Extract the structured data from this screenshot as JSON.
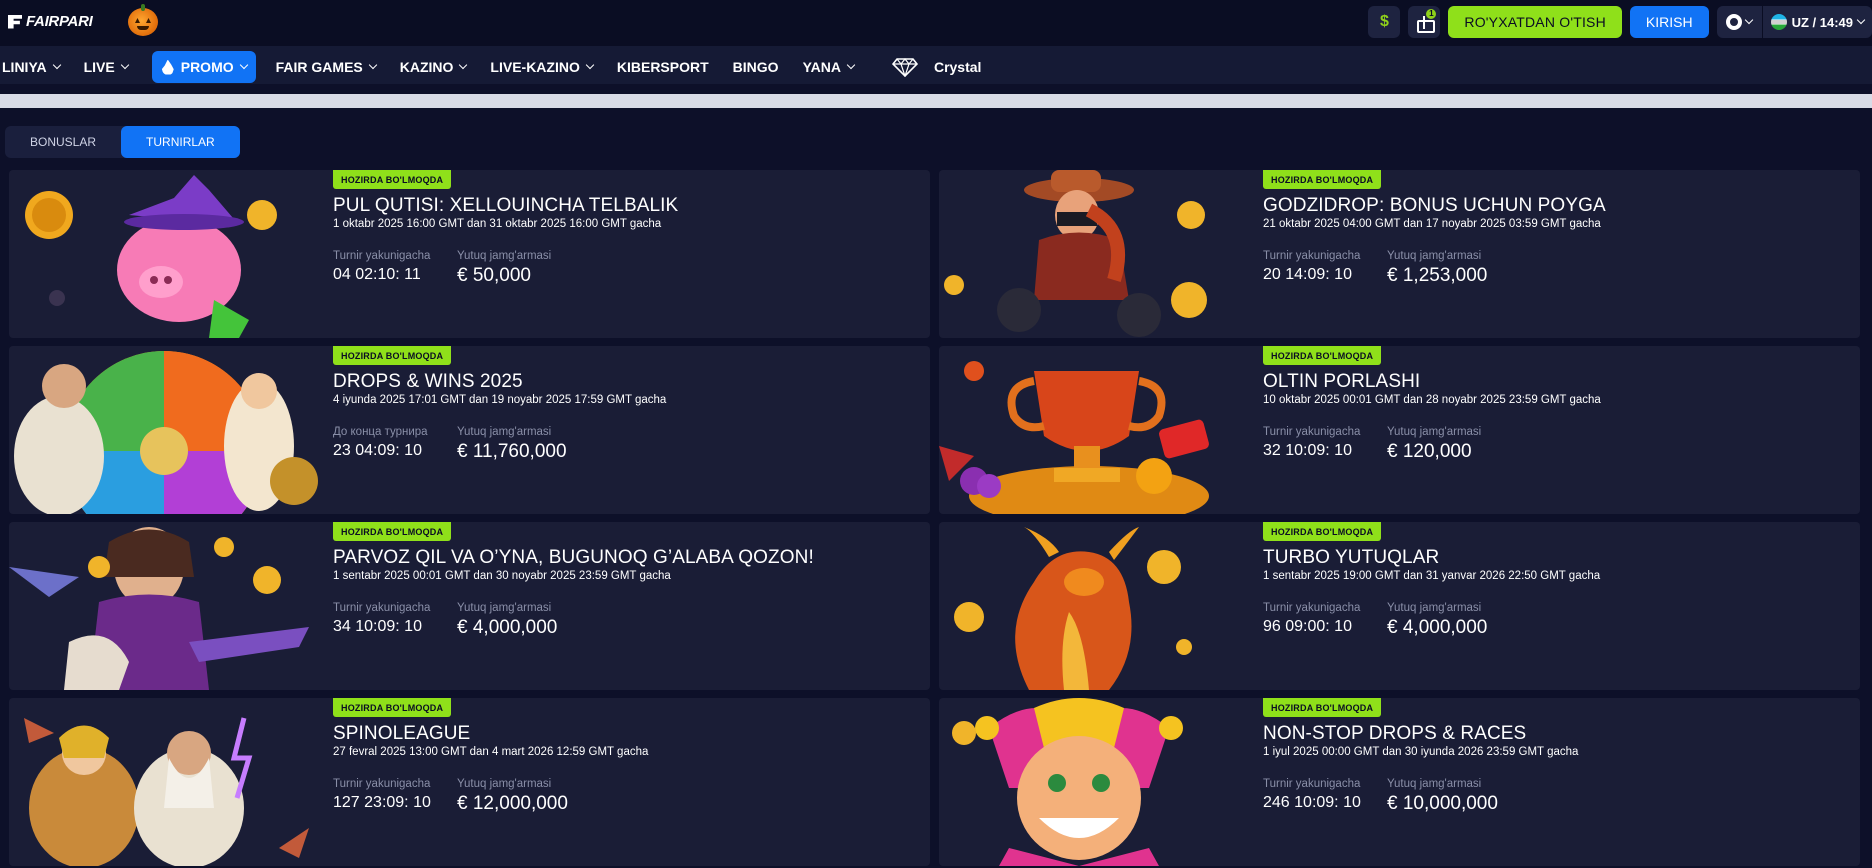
{
  "header": {
    "logo_text": "FAIRPARI",
    "gift_count": "1",
    "register_label": "RO'YXATDAN O'TISH",
    "login_label": "KIRISH",
    "lang_time": "UZ / 14:49"
  },
  "nav": {
    "items": [
      "LINIYA",
      "LIVE",
      "PROMO",
      "FAIR GAMES",
      "KAZINO",
      "LIVE-KAZINO",
      "KIBERSPORT",
      "BINGO",
      "YANA",
      "Crystal"
    ]
  },
  "tabs": [
    "BONUSLAR",
    "TURNIRLAR"
  ],
  "cards": [
    {
      "badge": "HOZIRDA BO'LMOQDA",
      "title": "PUL QUTISI: XELLOUINCHA TELBALIK",
      "dates": "1 oktabr 2025 16:00 GMT dan 31 oktabr 2025 16:00 GMT gacha",
      "timer_label": "Turnir yakunigacha",
      "timer": "04 02:10: 11",
      "prize_label": "Yutuq jamg'armasi",
      "prize": "€ 50,000",
      "art": "piggy-witch"
    },
    {
      "badge": "HOZIRDA BO'LMOQDA",
      "title": "GODZIDROP: BONUS UCHUN POYGA",
      "dates": "21 oktabr 2025 04:00 GMT dan 17 noyabr 2025 03:59 GMT gacha",
      "timer_label": "Turnir yakunigacha",
      "timer": "20 14:09: 10",
      "prize_label": "Yutuq jamg'armasi",
      "prize": "€ 1,253,000",
      "art": "cowgirl-biker"
    },
    {
      "badge": "HOZIRDA BO'LMOQDA",
      "title": "DROPS & WINS 2025",
      "dates": "4 iyunda 2025 17:01 GMT dan 19 noyabr 2025 17:59 GMT gacha",
      "timer_label": "До конца турнира",
      "timer": "23 04:09: 10",
      "prize_label": "Yutuq jamg'armasi",
      "prize": "€ 11,760,000",
      "art": "zeus-wheel"
    },
    {
      "badge": "HOZIRDA BO'LMOQDA",
      "title": "OLTIN PORLASHI",
      "dates": "10 oktabr 2025 00:01 GMT dan 28 noyabr 2025 23:59 GMT gacha",
      "timer_label": "Turnir yakunigacha",
      "timer": "32 10:09: 10",
      "prize_label": "Yutuq jamg'armasi",
      "prize": "€ 120,000",
      "art": "golden-cup"
    },
    {
      "badge": "HOZIRDA BO'LMOQDA",
      "title": "PARVOZ QIL VA O’YNA, BUGUNOQ G’ALABA QOZON!",
      "dates": "1 sentabr 2025 00:01 GMT dan 30 noyabr 2025 23:59 GMT gacha",
      "timer_label": "Turnir yakunigacha",
      "timer": "34 10:09: 10",
      "prize_label": "Yutuq jamg'armasi",
      "prize": "€ 4,000,000",
      "art": "aviator-girl"
    },
    {
      "badge": "HOZIRDA BO'LMOQDA",
      "title": "TURBO YUTUQLAR",
      "dates": "1 sentabr 2025 19:00 GMT dan 31 yanvar 2026 22:50 GMT gacha",
      "timer_label": "Turnir yakunigacha",
      "timer": "96 09:00: 10",
      "prize_label": "Yutuq jamg'armasi",
      "prize": "€ 4,000,000",
      "art": "fire-dragon"
    },
    {
      "badge": "HOZIRDA BO'LMOQDA",
      "title": "SPINOLEAGUE",
      "dates": "27 fevral 2025 13:00 GMT dan 4 mart 2026 12:59 GMT gacha",
      "timer_label": "Turnir yakunigacha",
      "timer": "127 23:09: 10",
      "prize_label": "Yutuq jamg'armasi",
      "prize": "€ 12,000,000",
      "art": "zeus-athena"
    },
    {
      "badge": "HOZIRDA BO'LMOQDA",
      "title": "NON-STOP DROPS & RACES",
      "dates": "1 iyul 2025 00:00 GMT dan 30 iyunda 2026 23:59 GMT gacha",
      "timer_label": "Turnir yakunigacha",
      "timer": "246 10:09: 10",
      "prize_label": "Yutuq jamg'armasi",
      "prize": "€ 10,000,000",
      "art": "jester"
    }
  ]
}
